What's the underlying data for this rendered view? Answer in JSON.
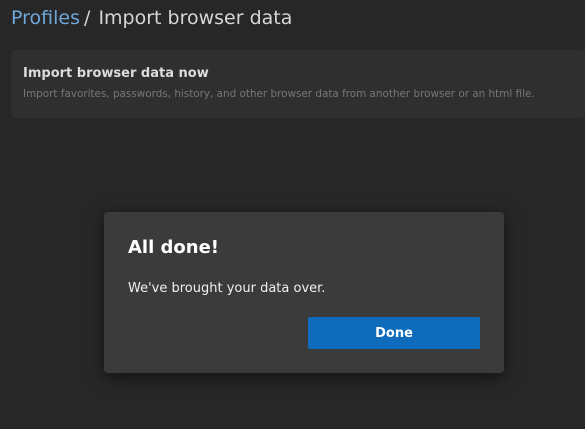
{
  "breadcrumb": {
    "parent": "Profiles",
    "separator": "/",
    "current": "Import browser data"
  },
  "import_card": {
    "title": "Import browser data now",
    "description": "Import favorites, passwords, history, and other browser data from another browser or an html file."
  },
  "dialog": {
    "title": "All done!",
    "message": "We've brought your data over.",
    "done_label": "Done"
  },
  "colors": {
    "accent": "#0f6cbd",
    "link": "#6ea7d9",
    "background": "#272727"
  }
}
